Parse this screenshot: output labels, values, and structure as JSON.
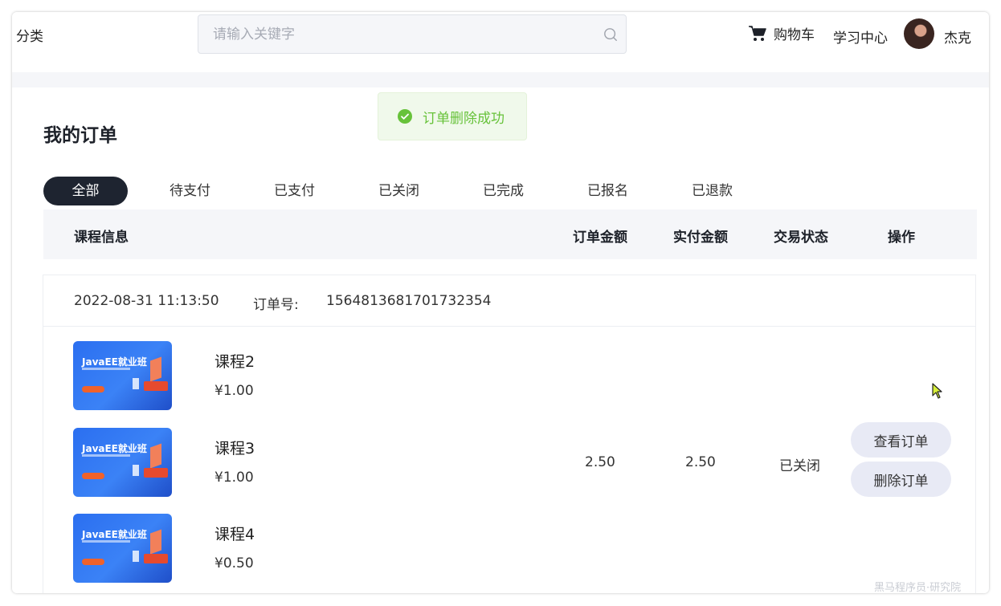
{
  "header": {
    "category_label": "分类",
    "search_placeholder": "请输入关键字",
    "cart_label": "购物车",
    "learning_center_label": "学习中心",
    "username": "杰克"
  },
  "toast": {
    "message": "订单删除成功",
    "color": "#67c23a"
  },
  "page": {
    "title": "我的订单"
  },
  "tabs": [
    {
      "label": "全部",
      "active": true
    },
    {
      "label": "待支付",
      "active": false
    },
    {
      "label": "已支付",
      "active": false
    },
    {
      "label": "已关闭",
      "active": false
    },
    {
      "label": "已完成",
      "active": false
    },
    {
      "label": "已报名",
      "active": false
    },
    {
      "label": "已退款",
      "active": false
    }
  ],
  "table_headers": {
    "course_info": "课程信息",
    "order_amount": "订单金额",
    "paid_amount": "实付金额",
    "status": "交易状态",
    "actions": "操作"
  },
  "orders": [
    {
      "time": "2022-08-31 11:13:50",
      "order_no_label": "订单号:",
      "order_no": "1564813681701732354",
      "courses": [
        {
          "thumb_title": "JavaEE就业班",
          "name": "课程2",
          "price": "¥1.00"
        },
        {
          "thumb_title": "JavaEE就业班",
          "name": "课程3",
          "price": "¥1.00"
        },
        {
          "thumb_title": "JavaEE就业班",
          "name": "课程4",
          "price": "¥0.50"
        }
      ],
      "order_amount": "2.50",
      "paid_amount": "2.50",
      "status": "已关闭",
      "view_button": "查看订单",
      "delete_button": "删除订单"
    }
  ],
  "watermark": "黑马程序员·研究院",
  "colors": {
    "active_tab_bg": "#1e2430",
    "button_bg": "#e8eaf5",
    "page_bg": "#f5f6f9"
  }
}
